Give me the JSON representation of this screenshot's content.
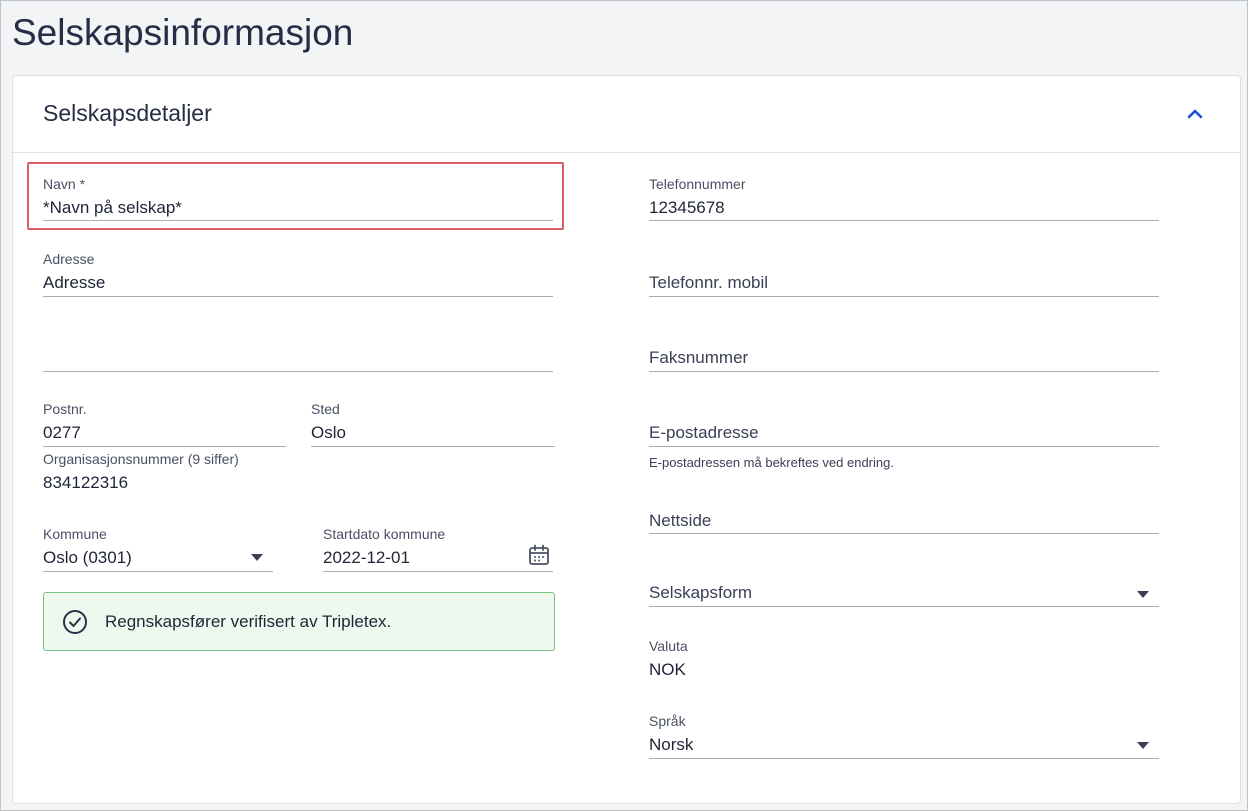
{
  "page": {
    "title": "Selskapsinformasjon"
  },
  "section": {
    "title": "Selskapsdetaljer",
    "collapse_icon": "chevron-up-icon",
    "accent": "#1d4ed8"
  },
  "fields": {
    "navn": {
      "label": "Navn *",
      "value": "*Navn på selskap*"
    },
    "adresse": {
      "label": "Adresse",
      "value": "Adresse"
    },
    "adresse2": {
      "value": ""
    },
    "postnr": {
      "label": "Postnr.",
      "value": "0277"
    },
    "sted": {
      "label": "Sted",
      "value": "Oslo"
    },
    "orgnr": {
      "label": "Organisasjonsnummer (9 siffer)",
      "value": "834122316"
    },
    "kommune": {
      "label": "Kommune",
      "value": "Oslo (0301)"
    },
    "startdato": {
      "label": "Startdato kommune",
      "value": "2022-12-01"
    },
    "telefon": {
      "label": "Telefonnummer",
      "value": "12345678"
    },
    "mobil": {
      "placeholder": "Telefonnr. mobil"
    },
    "faks": {
      "placeholder": "Faksnummer"
    },
    "epost": {
      "placeholder": "E-postadresse",
      "hint": "E-postadressen må bekreftes ved endring."
    },
    "nettside": {
      "placeholder": "Nettside"
    },
    "selskapsform": {
      "placeholder": "Selskapsform"
    },
    "valuta": {
      "label": "Valuta",
      "value": "NOK"
    },
    "sprak": {
      "label": "Språk",
      "value": "Norsk"
    }
  },
  "verified_banner": {
    "text": "Regnskapsfører verifisert av Tripletex.",
    "icon": "check-circle-icon",
    "bg": "#eef8ee",
    "border": "#7ac27e"
  },
  "highlight_color": "#e05b6b"
}
